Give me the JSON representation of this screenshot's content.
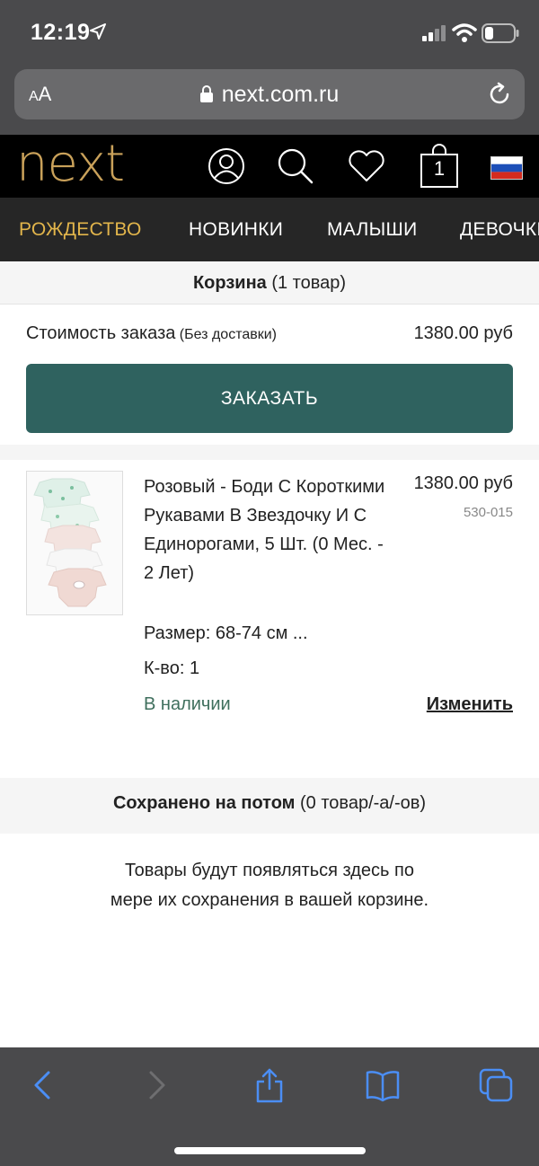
{
  "status_bar": {
    "time": "12:19"
  },
  "browser": {
    "text_size_label_small": "A",
    "text_size_label_large": "A",
    "url": "next.com.ru"
  },
  "header": {
    "logo": "next",
    "bag_count": "1"
  },
  "categories": [
    "РОЖДЕСТВО",
    "НОВИНКИ",
    "МАЛЫШИ",
    "ДЕВОЧКИ"
  ],
  "basket": {
    "title": "Корзина",
    "count": " (1 товар)",
    "order_cost_label": "Стоимость заказа",
    "order_cost_note": " (Без доставки)",
    "order_total": "1380.00 руб",
    "checkout_label": "ЗАКАЗАТЬ"
  },
  "item": {
    "name": "Розовый - Боди С Короткими Рукавами В Звездочку И С Единорогами, 5 Шт. (0 Мес. - 2 Лет)",
    "price": "1380.00 руб",
    "code": "530-015",
    "size": "Размер: 68-74 см ...",
    "qty": "К-во: 1",
    "stock": "В наличии",
    "edit_label": "Изменить"
  },
  "saved": {
    "title": "Сохранено на потом",
    "count": " (0 товар/-а/-ов)",
    "empty_line1": "Товары будут появляться здесь по",
    "empty_line2": "мере их сохранения в вашей корзине."
  },
  "colors": {
    "accent_gold": "#c9a15a",
    "checkout_green": "#2f625f",
    "stock_green": "#3f6f5d"
  }
}
